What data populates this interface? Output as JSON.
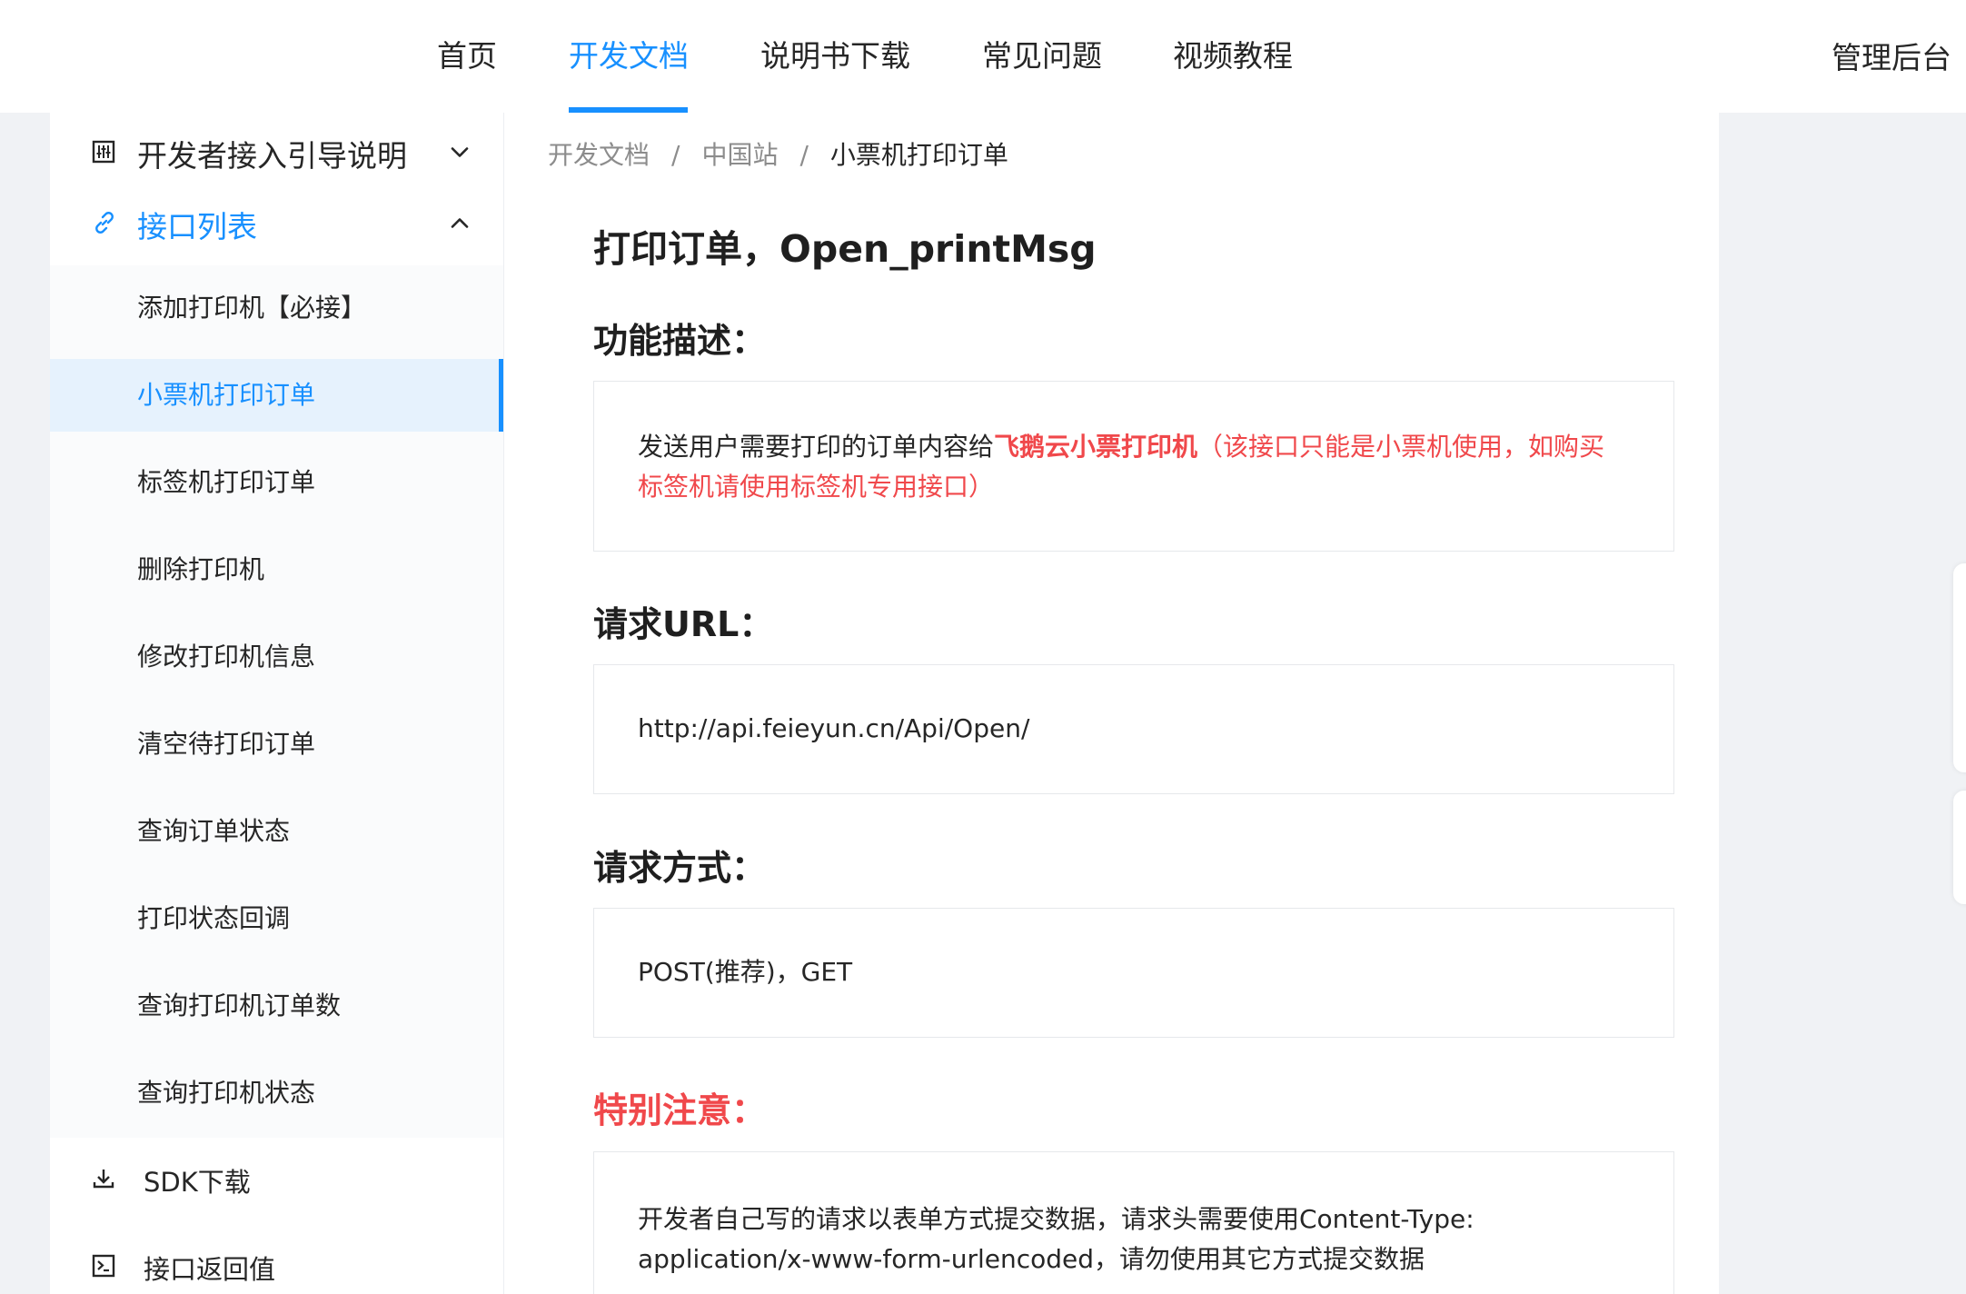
{
  "nav": {
    "items": [
      {
        "label": "首页",
        "active": false
      },
      {
        "label": "开发文档",
        "active": true
      },
      {
        "label": "说明书下载",
        "active": false
      },
      {
        "label": "常见问题",
        "active": false
      },
      {
        "label": "视频教程",
        "active": false
      }
    ],
    "admin": "管理后台"
  },
  "sidebar": {
    "guide": {
      "label": "开发者接入引导说明"
    },
    "api_list": {
      "label": "接口列表"
    },
    "sub_items": [
      {
        "label": "添加打印机【必接】"
      },
      {
        "label": "小票机打印订单"
      },
      {
        "label": "标签机打印订单"
      },
      {
        "label": "删除打印机"
      },
      {
        "label": "修改打印机信息"
      },
      {
        "label": "清空待打印订单"
      },
      {
        "label": "查询订单状态"
      },
      {
        "label": "打印状态回调"
      },
      {
        "label": "查询打印机订单数"
      },
      {
        "label": "查询打印机状态"
      }
    ],
    "sdk": {
      "label": "SDK下载"
    },
    "returns": {
      "label": "接口返回值"
    }
  },
  "breadcrumb": {
    "items": [
      "开发文档",
      "中国站",
      "小票机打印订单"
    ],
    "separator": "/"
  },
  "doc": {
    "title": "打印订单，Open_printMsg",
    "function": {
      "heading": "功能描述：",
      "text_plain": "发送用户需要打印的订单内容给",
      "text_highlight": "飞鹅云小票打印机",
      "text_note": "（该接口只能是小票机使用，如购买标签机请使用标签机专用接口）"
    },
    "url": {
      "heading": "请求URL：",
      "value": "http://api.feieyun.cn/Api/Open/"
    },
    "method": {
      "heading": "请求方式：",
      "value": "POST(推荐)，GET"
    },
    "notice": {
      "heading": "特别注意：",
      "text": "开发者自己写的请求以表单方式提交数据，请求头需要使用Content-Type: application/x-www-form-urlencoded，请勿使用其它方式提交数据"
    }
  },
  "colors": {
    "accent": "#1890ff",
    "warning": "#f0484b",
    "active_bg": "#e6f2fd"
  }
}
